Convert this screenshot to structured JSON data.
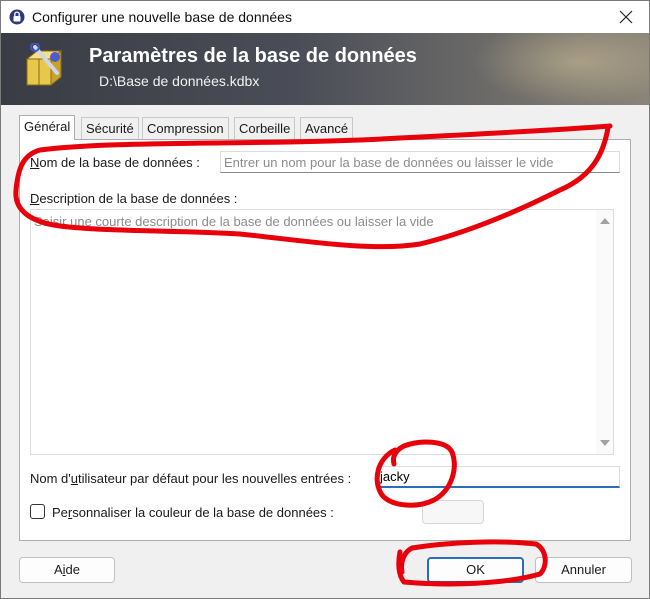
{
  "window": {
    "title": "Configurer une nouvelle base de données",
    "close_icon": "close-icon"
  },
  "banner": {
    "title": "Paramètres de la base de données",
    "subtitle": "D:\\Base de données.kdbx"
  },
  "tabs": [
    {
      "label": "Général",
      "active": true
    },
    {
      "label": "Sécurité",
      "active": false
    },
    {
      "label": "Compression",
      "active": false
    },
    {
      "label": "Corbeille",
      "active": false
    },
    {
      "label": "Avancé",
      "active": false
    }
  ],
  "general": {
    "db_name_label_mnemonic": "N",
    "db_name_label_rest": "om de la base de données :",
    "db_name_placeholder": "Entrer un nom pour la base de données ou laisser le vide",
    "db_name_value": "",
    "description_label_mnemonic": "D",
    "description_label_rest": "escription de la base de données :",
    "description_placeholder": "Saisir une courte description de la base de données ou laisser la vide",
    "default_user_label_pre": "Nom d'",
    "default_user_label_mnemonic": "u",
    "default_user_label_post": "tilisateur par défaut pour les nouvelles entrées :",
    "default_user_value": "jacky",
    "custom_color_pre": "Pe",
    "custom_color_mnemonic": "r",
    "custom_color_post": "sonnaliser la couleur de la base de données :",
    "custom_color_checked": false
  },
  "buttons": {
    "help_pre": "A",
    "help_mnemonic": "i",
    "help_post": "de",
    "ok": "OK",
    "cancel": "Annuler"
  },
  "colors": {
    "accent": "#2a6ebb",
    "annotation": "#e8000b"
  }
}
